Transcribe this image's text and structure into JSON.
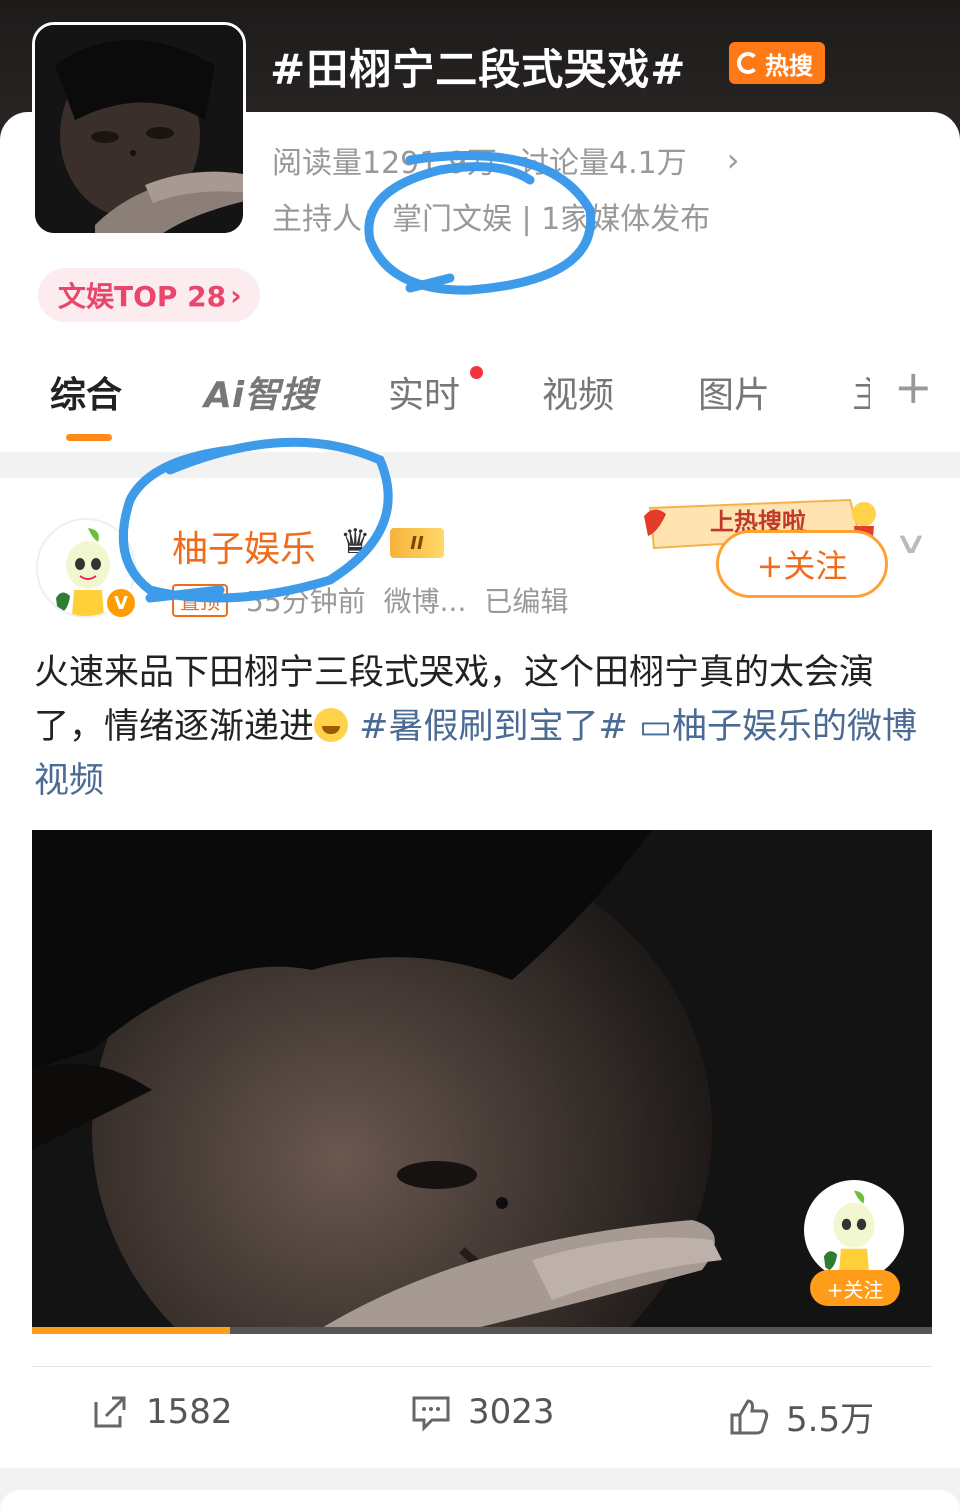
{
  "header": {
    "topic_title": "#田栩宁二段式哭戏#",
    "hot_badge": "热搜",
    "read_label": "阅读量1291.9万",
    "discuss_label": "讨论量4.1万",
    "host_label": "主持人：掌门文娱 | 1家媒体发布",
    "rank_pill": "文娱TOP 28",
    "rank_chevron": "›",
    "stats_chevron": "›"
  },
  "tabs": [
    {
      "label": "综合",
      "active": true
    },
    {
      "label": "Ai智搜",
      "active": false
    },
    {
      "label": "实时",
      "active": false
    },
    {
      "label": "视频",
      "active": false
    },
    {
      "label": "图片",
      "active": false
    },
    {
      "label": "主",
      "active": false
    }
  ],
  "tab_plus": "+",
  "post": {
    "author": "柚子娱乐",
    "level": "II",
    "vip_badge": "V",
    "top_tag": "置顶",
    "time": "55分钟前",
    "source": "微博...",
    "edited": "已编辑",
    "follow": "+关注",
    "banner_text": "上热搜啦",
    "text_main": "火速来品下田栩宁三段式哭戏，这个田栩宁真的太会演了，情绪逐渐递进",
    "hashtag": "#暑假刷到宝了#",
    "video_link": "柚子娱乐的微博视频",
    "video_progress": 0.22,
    "float_follow": "+关注"
  },
  "actions": {
    "repost": "1582",
    "comment": "3023",
    "like": "5.5万"
  },
  "colors": {
    "accent": "#ff8a1a",
    "link": "#4b6a94",
    "annotation": "#3d9be9"
  }
}
